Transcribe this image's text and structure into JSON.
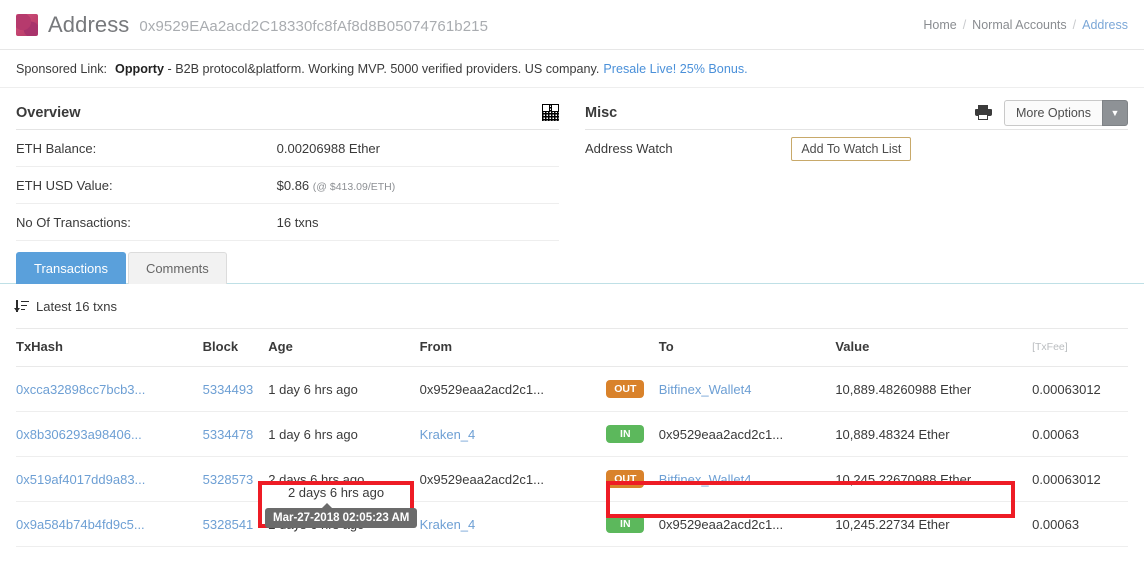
{
  "header": {
    "title": "Address",
    "address": "0x9529EAa2acd2C18330fc8fAf8d8B05074761b215",
    "identicon_icon": "identicon-square"
  },
  "breadcrumb": {
    "home": "Home",
    "sep1": "/",
    "normal_accounts": "Normal Accounts",
    "sep2": "/",
    "current": "Address"
  },
  "sponsored": {
    "label": "Sponsored Link:",
    "brand": "Opporty",
    "body": "- B2B protocol&platform. Working MVP. 5000 verified providers. US company.",
    "promo": "Presale Live! 25% Bonus."
  },
  "overview": {
    "title": "Overview",
    "qr_icon": "qr-code-icon",
    "rows": [
      {
        "key": "ETH Balance:",
        "value": "0.00206988 Ether",
        "sub": ""
      },
      {
        "key": "ETH USD Value:",
        "value": "$0.86",
        "sub": "(@ $413.09/ETH)"
      },
      {
        "key": "No Of Transactions:",
        "value": "16 txns",
        "sub": ""
      }
    ]
  },
  "misc": {
    "title": "Misc",
    "print_icon": "printer-icon",
    "more_options_label": "More Options",
    "caret_icon": "chevron-down-icon",
    "address_watch_label": "Address Watch",
    "add_watch_label": "Add To Watch List"
  },
  "tabs": [
    {
      "label": "Transactions",
      "active": true
    },
    {
      "label": "Comments",
      "active": false
    }
  ],
  "table": {
    "latest_label": "Latest 16 txns",
    "sort_icon": "sort-descending-icon",
    "columns": [
      "TxHash",
      "Block",
      "Age",
      "From",
      "",
      "To",
      "Value",
      "[TxFee]"
    ],
    "rows": [
      {
        "txhash": "0xcca32898cc7bcb3...",
        "block": "5334493",
        "age": "1 day 6 hrs ago",
        "from": "0x9529eaa2acd2c1...",
        "from_link": false,
        "dir": "OUT",
        "to": "Bitfinex_Wallet4",
        "to_link": true,
        "value": "10,889.48260988 Ether",
        "fee": "0.00063012"
      },
      {
        "txhash": "0x8b306293a98406...",
        "block": "5334478",
        "age": "1 day 6 hrs ago",
        "from": "Kraken_4",
        "from_link": true,
        "dir": "IN",
        "to": "0x9529eaa2acd2c1...",
        "to_link": false,
        "value": "10,889.48324 Ether",
        "fee": "0.00063"
      },
      {
        "txhash": "0x519af4017dd9a83...",
        "block": "5328573",
        "age": "2 days 6 hrs ago",
        "from": "0x9529eaa2acd2c1...",
        "from_link": false,
        "dir": "OUT",
        "to": "Bitfinex_Wallet4",
        "to_link": true,
        "value": "10,245.22670988 Ether",
        "fee": "0.00063012"
      },
      {
        "txhash": "0x9a584b74b4fd9c5...",
        "block": "5328541",
        "age": "2 days 6 hrs ago",
        "from": "Kraken_4",
        "from_link": true,
        "dir": "IN",
        "to": "0x9529eaa2acd2c1...",
        "to_link": false,
        "value": "10,245.22734 Ether",
        "fee": "0.00063"
      }
    ]
  },
  "annotations": {
    "tooltip_text": "Mar-27-2018 02:05:23 AM",
    "highlight_color": "#ee1c25",
    "highlighted_age_text": "2 days 6 hrs ago"
  }
}
